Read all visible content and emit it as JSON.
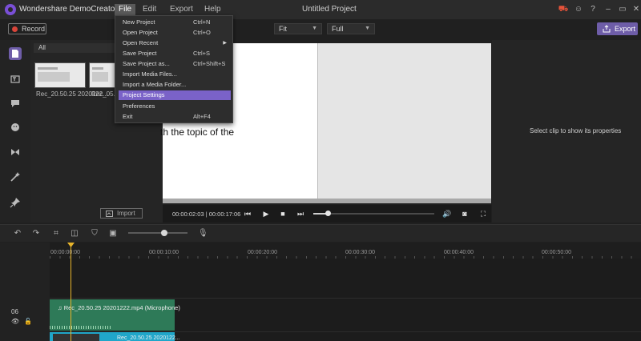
{
  "app": {
    "name": "Wondershare DemoCreator",
    "document_title": "Untitled Project",
    "colors": {
      "accent": "#6e5da8",
      "menu_highlight": "#7a62c8",
      "playhead": "#e8b42b",
      "audio_clip": "#2e7a58",
      "video_clip": "#20a6c9"
    }
  },
  "menubar": {
    "file": "File",
    "edit": "Edit",
    "export": "Export",
    "help": "Help"
  },
  "window_controls": [
    "cart-icon",
    "user-icon",
    "help-icon",
    "minimize-icon",
    "maximize-icon",
    "close-icon"
  ],
  "toolbar": {
    "record_label": "Record",
    "fit_select": "Fit",
    "full_select": "Full",
    "export_label": "Export"
  },
  "file_menu": {
    "items": [
      {
        "label": "New Project",
        "shortcut": "Ctrl+N"
      },
      {
        "label": "Open Project",
        "shortcut": "Ctrl+O"
      },
      {
        "label": "Open Recent",
        "shortcut": ""
      },
      {
        "label": "Save Project",
        "shortcut": "Ctrl+S"
      },
      {
        "label": "Save Project as...",
        "shortcut": "Ctrl+Shift+S"
      },
      {
        "label": "Import Media Files...",
        "shortcut": ""
      },
      {
        "label": "Import a Media Folder...",
        "shortcut": ""
      },
      {
        "label": "Project Settings",
        "shortcut": ""
      },
      {
        "label": "Preferences",
        "shortcut": ""
      },
      {
        "label": "Exit",
        "shortcut": "Alt+F4"
      }
    ],
    "highlighted": "Project Settings"
  },
  "media": {
    "filter": "All",
    "clips": [
      "Rec_20.50.25 2020122...",
      "Rec_05.2..."
    ],
    "import_label": "Import"
  },
  "preview": {
    "caption": "th the topic of the",
    "timecode": "00:00:02:03 | 00:00:17:06",
    "progress": 0.12
  },
  "properties": {
    "empty_text": "Select clip to show its properties"
  },
  "timeline": {
    "ticks": [
      "00:00:00:00",
      "00:00:10:00",
      "00:00:20:00",
      "00:00:30:00",
      "00:00:40:00",
      "00:00:50:00"
    ],
    "track_number": "06",
    "audio_clip_label": "Rec_20.50.25 20201222.mp4 (Microphone)",
    "video_clip_label": "Rec_20.50.25 2020122..."
  }
}
